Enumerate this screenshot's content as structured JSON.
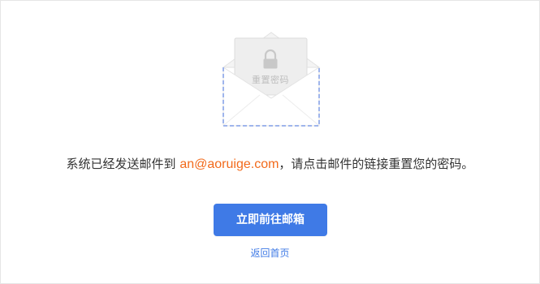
{
  "illustration": {
    "icon": "envelope-lock-icon",
    "letter_text": "重置密码"
  },
  "message": {
    "prefix": "系统已经发送邮件到 ",
    "email": "an@aoruige.com",
    "suffix": "，请点击邮件的链接重置您的密码。"
  },
  "actions": {
    "primary_label": "立即前往邮箱",
    "back_label": "返回首页"
  },
  "colors": {
    "accent": "#3f7ae6",
    "email": "#f26a1b",
    "text": "#333333"
  }
}
